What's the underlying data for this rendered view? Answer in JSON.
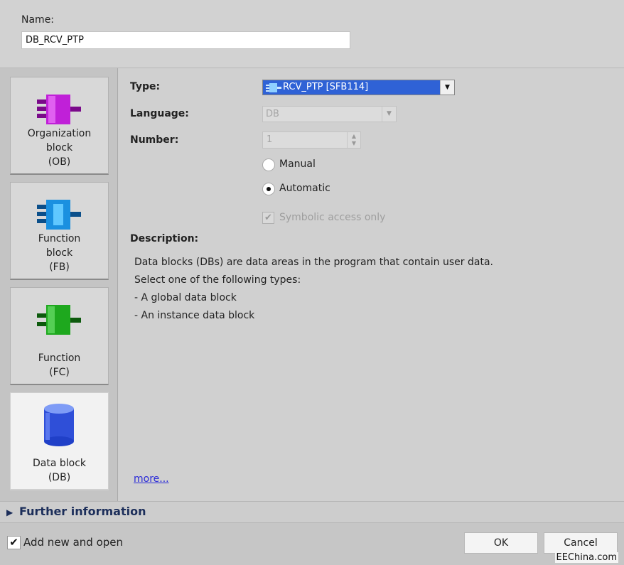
{
  "name": {
    "label": "Name:",
    "value": "DB_RCV_PTP"
  },
  "block_types": [
    {
      "label": "Organization\nblock\n(OB)",
      "icon": "organization-block-icon",
      "color": "#b000c8"
    },
    {
      "label": "Function\nblock\n(FB)",
      "icon": "function-block-icon",
      "color": "#1e8fe0"
    },
    {
      "label": "Function\n(FC)",
      "icon": "function-icon",
      "color": "#1ea81e"
    },
    {
      "label": "Data block\n(DB)",
      "icon": "data-block-icon",
      "color": "#2f4fd8"
    }
  ],
  "form": {
    "type_label": "Type:",
    "type_value": "RCV_PTP [SFB114]",
    "language_label": "Language:",
    "language_value": "DB",
    "number_label": "Number:",
    "number_value": "1",
    "manual_label": "Manual",
    "automatic_label": "Automatic",
    "symbolic_label": "Symbolic access only"
  },
  "description": {
    "label": "Description:",
    "lines": [
      "Data blocks (DBs) are data areas in the program that contain user data.",
      "Select one of the following types:",
      "- A global data block",
      "- An instance data block"
    ],
    "more_link": "more..."
  },
  "further_info": "Further information",
  "footer": {
    "add_new_label": "Add new and open",
    "ok_label": "OK",
    "cancel_label": "Cancel"
  },
  "watermark": "EEChina.com"
}
